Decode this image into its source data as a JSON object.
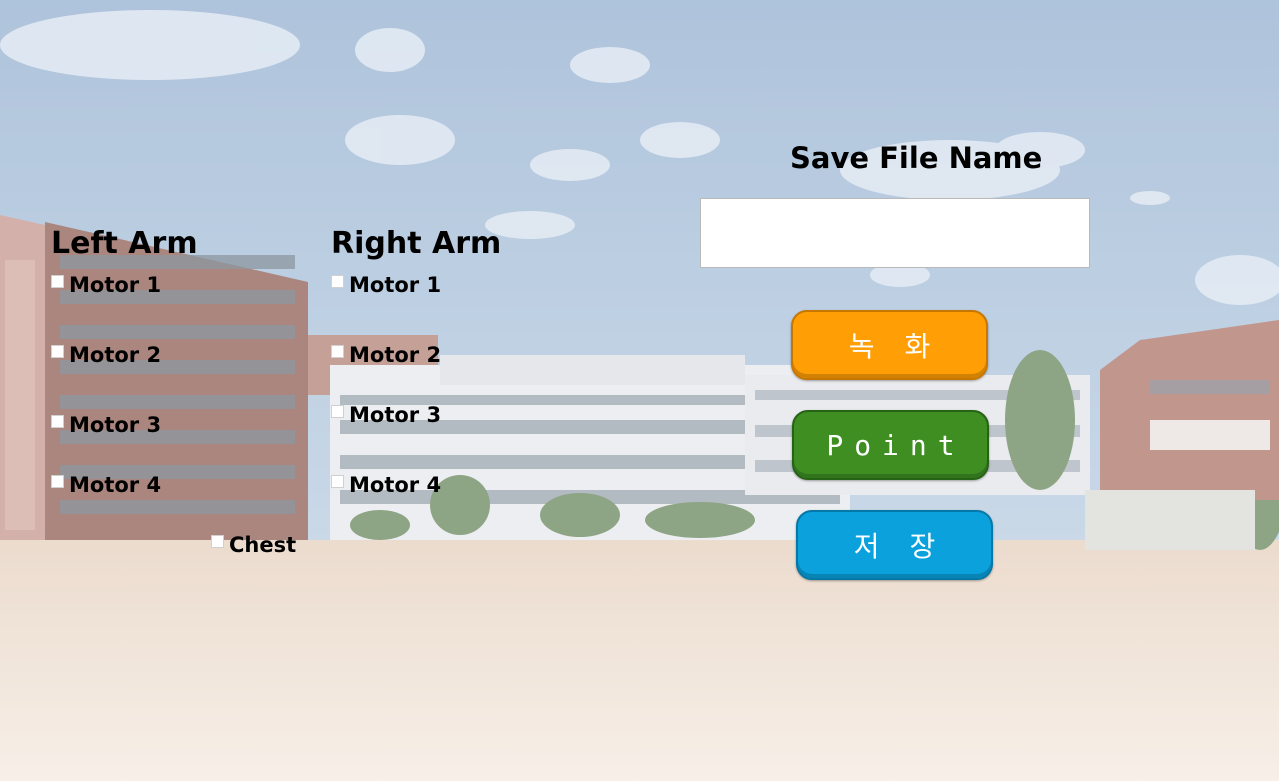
{
  "background": {
    "scene": "school-courtyard-photo",
    "colors": {
      "sky": "#a9c2dc",
      "ground": "#efe1d3",
      "brick": "#9a6558",
      "school_wall": "#e9ebee"
    }
  },
  "left_arm": {
    "title": "Left Arm",
    "motors": [
      "Motor 1",
      "Motor 2",
      "Motor 3",
      "Motor 4"
    ]
  },
  "right_arm": {
    "title": "Right Arm",
    "motors": [
      "Motor 1",
      "Motor 2",
      "Motor 3",
      "Motor 4"
    ]
  },
  "chest": {
    "label": "Chest"
  },
  "save": {
    "title": "Save File Name",
    "value": ""
  },
  "buttons": {
    "record_label": "녹화",
    "point_label": "Point",
    "save_label": "저장"
  },
  "colors": {
    "record": "#ff9f05",
    "point": "#3e8e22",
    "save": "#0aa1dd"
  }
}
